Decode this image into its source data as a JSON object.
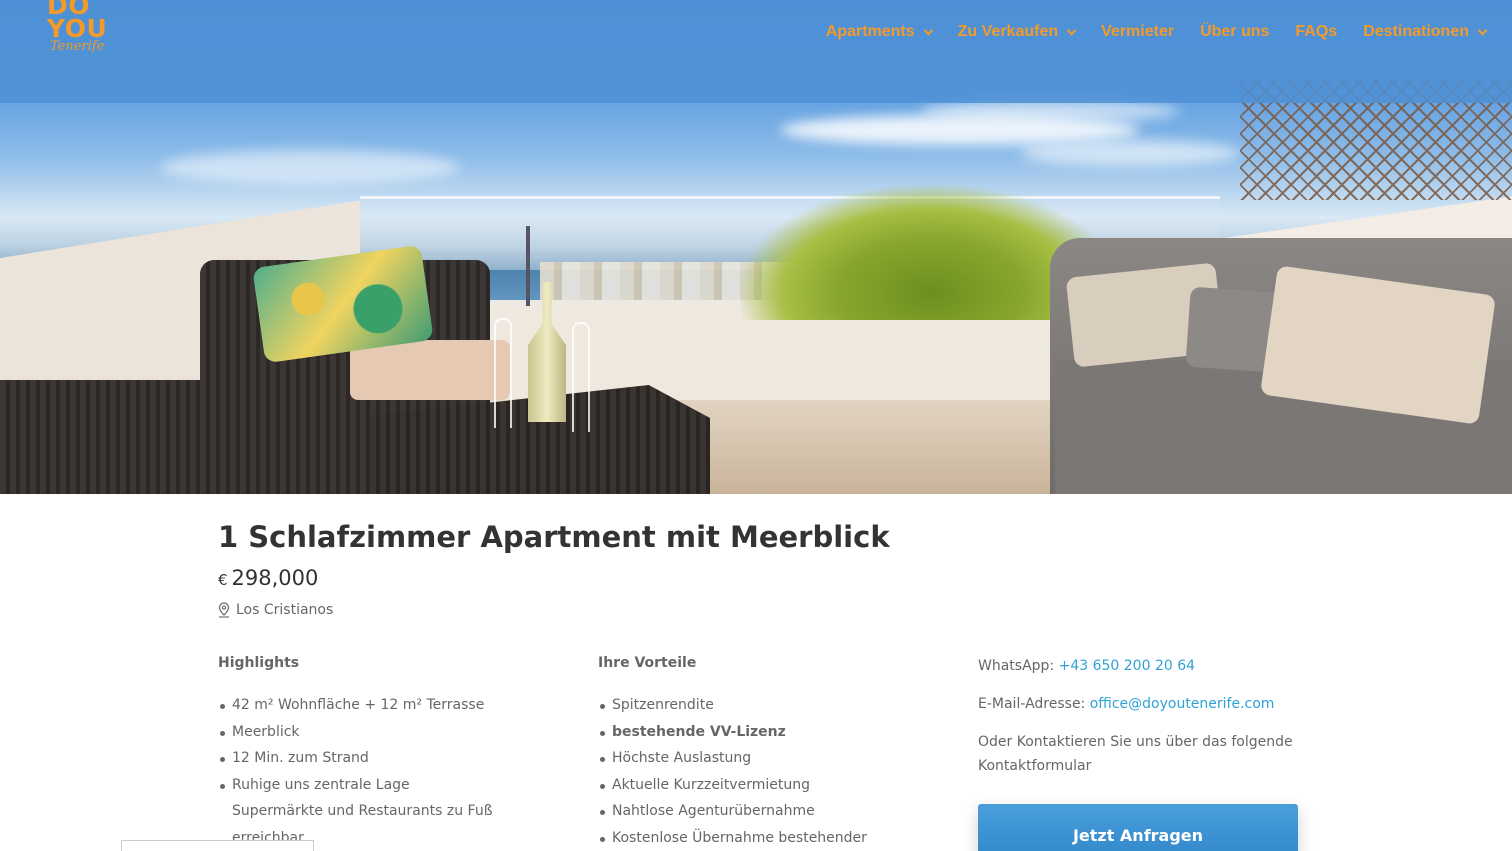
{
  "header": {
    "logo": {
      "line1": "DO",
      "line2": "YOU",
      "sub": "Tenerife"
    },
    "nav": [
      {
        "label": "Apartments",
        "has_dropdown": true
      },
      {
        "label": "Zu Verkaufen",
        "has_dropdown": true
      },
      {
        "label": "Vermieter",
        "has_dropdown": false
      },
      {
        "label": "Über uns",
        "has_dropdown": false
      },
      {
        "label": "FAQs",
        "has_dropdown": false
      },
      {
        "label": "Destinationen",
        "has_dropdown": true
      }
    ]
  },
  "listing": {
    "title": "1 Schlafzimmer Apartment mit Meerblick",
    "currency": "€",
    "price": "298,000",
    "location": "Los Cristianos"
  },
  "highlights": {
    "heading": "Highlights",
    "items": [
      "42 m² Wohnfläche + 12 m² Terrasse",
      "Meerblick",
      "12 Min. zum Strand",
      "Ruhige uns zentrale Lage",
      "Supermärkte und Restaurants zu Fuß",
      "erreichbar"
    ]
  },
  "advantages": {
    "heading": "Ihre Vorteile",
    "items": [
      "Spitzenrendite",
      "bestehende VV-Lizenz",
      "Höchste Auslastung",
      "Aktuelle Kurzzeitvermietung",
      "Nahtlose Agenturübernahme",
      "Kostenlose Übernahme bestehender"
    ]
  },
  "contact": {
    "whatsapp_label": "WhatsApp:",
    "whatsapp_number": "+43 650 200 20 64",
    "email_label": "E-Mail-Adresse:",
    "email": "office@doyoutenerife.com",
    "note": "Oder Kontaktieren Sie uns über das folgende Kontaktformular",
    "cta_label": "Jetzt Anfragen"
  },
  "colors": {
    "accent": "#f39a2a",
    "header_bg": "#4f91d5",
    "link": "#2ea3d6",
    "cta": "#3a92d2",
    "title_text": "#333333",
    "body_text": "#666666"
  },
  "icons": {
    "location": "map-pin-icon",
    "dropdown": "chevron-down-icon"
  }
}
